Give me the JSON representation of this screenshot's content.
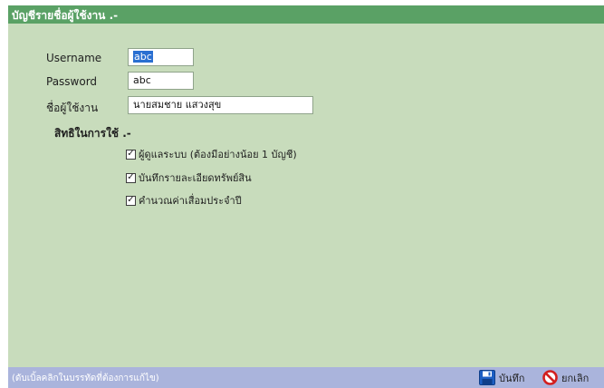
{
  "window": {
    "header_title": "บัญชีรายชื่อผู้ใช้งาน .-"
  },
  "form": {
    "username_label": "Username",
    "username_value": "abc",
    "password_label": "Password",
    "password_value": "abc",
    "fullname_label": "ชื่อผู้ใช้งาน",
    "fullname_value": "นายสมชาย แสวงสุข"
  },
  "permissions": {
    "title": "สิทธิในการใช้ .-",
    "items": [
      {
        "label": "ผู้ดูแลระบบ (ต้องมีอย่างน้อย 1 บัญชี)",
        "checked": true
      },
      {
        "label": "บันทึกรายละเอียดทรัพย์สิน",
        "checked": true
      },
      {
        "label": "คำนวณค่าเสื่อมประจำปี",
        "checked": true
      }
    ]
  },
  "footer": {
    "hint": "(ดับเบิ้ลคลิกในบรรทัดที่ต้องการแก้ไข)",
    "save_label": "บันทึก",
    "cancel_label": "ยกเลิก"
  },
  "colors": {
    "panel_bg": "#c8dcbc",
    "header_bg": "#5aa165",
    "footer_bg": "#aab4dc",
    "selection": "#2a6fd1"
  },
  "icons": {
    "save": "floppy-disk-icon",
    "cancel": "prohibited-icon",
    "check": "checkmark"
  }
}
